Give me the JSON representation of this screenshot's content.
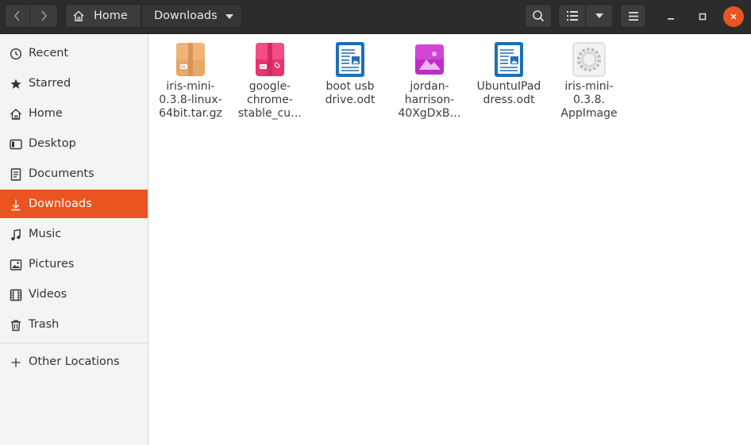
{
  "header": {
    "breadcrumb": [
      {
        "label": "Home"
      },
      {
        "label": "Downloads"
      }
    ]
  },
  "sidebar": {
    "items": [
      {
        "label": "Recent",
        "icon": "clock-icon"
      },
      {
        "label": "Starred",
        "icon": "star-icon"
      },
      {
        "label": "Home",
        "icon": "home-icon"
      },
      {
        "label": "Desktop",
        "icon": "desktop-icon"
      },
      {
        "label": "Documents",
        "icon": "document-icon"
      },
      {
        "label": "Downloads",
        "icon": "download-icon",
        "active": true
      },
      {
        "label": "Music",
        "icon": "music-icon"
      },
      {
        "label": "Pictures",
        "icon": "picture-icon"
      },
      {
        "label": "Videos",
        "icon": "video-icon"
      },
      {
        "label": "Trash",
        "icon": "trash-icon"
      }
    ],
    "other_locations": {
      "label": "Other Locations",
      "icon": "plus-icon"
    }
  },
  "files": [
    {
      "name": "iris-mini-\n0.3.8-linux-\n64bit.tar.gz",
      "icon": "archive-icon"
    },
    {
      "name": "google-\nchrome-\nstable_cu…",
      "icon": "deb-package-icon"
    },
    {
      "name": "boot usb\ndrive.odt",
      "icon": "text-document-icon"
    },
    {
      "name": "jordan-\nharrison-\n40XgDxB…",
      "icon": "image-file-icon"
    },
    {
      "name": "UbuntuIPad\ndress.odt",
      "icon": "text-document-icon"
    },
    {
      "name": "iris-mini-\n0.3.8.\nAppImage",
      "icon": "executable-gear-icon"
    }
  ],
  "colors": {
    "accent": "#e95420",
    "headerbar": "#2c2c2c",
    "sidebar": "#f4f4f4"
  }
}
